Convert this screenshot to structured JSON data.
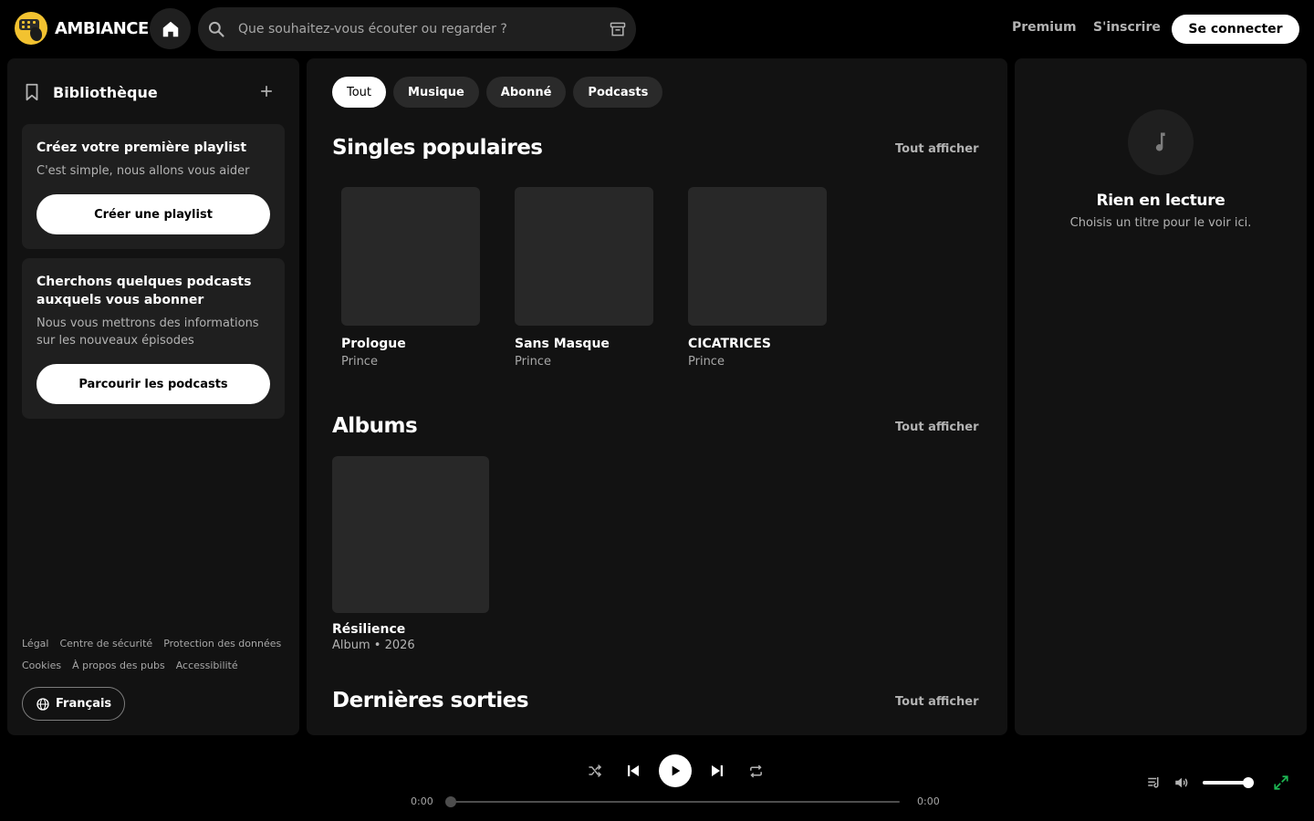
{
  "brand": {
    "name": "AMBIANCE"
  },
  "search": {
    "placeholder": "Que souhaitez-vous écouter ou regarder ?"
  },
  "top_nav": {
    "premium": "Premium",
    "signup": "S'inscrire",
    "login": "Se connecter"
  },
  "library": {
    "title": "Bibliothèque",
    "playlist_card": {
      "title": "Créez votre première playlist",
      "text": "C'est simple, nous allons vous aider",
      "button": "Créer une playlist"
    },
    "podcast_card": {
      "title": "Cherchons quelques podcasts auxquels vous abonner",
      "text": "Nous vous mettrons des informations sur les nouveaux épisodes",
      "button": "Parcourir les podcasts"
    },
    "legal_links": [
      "Légal",
      "Centre de sécurité",
      "Protection des données",
      "Cookies",
      "À propos des pubs",
      "Accessibilité"
    ],
    "language": "Français"
  },
  "filters": [
    "Tout",
    "Musique",
    "Abonné",
    "Podcasts"
  ],
  "sections": {
    "singles": {
      "title": "Singles populaires",
      "show_all": "Tout afficher",
      "items": [
        {
          "title": "Prologue",
          "artist": "Prince"
        },
        {
          "title": "Sans Masque",
          "artist": "Prince"
        },
        {
          "title": "CICATRICES",
          "artist": "Prince"
        }
      ]
    },
    "albums": {
      "title": "Albums",
      "show_all": "Tout afficher",
      "items": [
        {
          "title": "Résilience",
          "type": "Album",
          "year": "2026",
          "meta": "Album • 2026"
        }
      ]
    },
    "latest": {
      "title": "Dernières sorties",
      "show_all": "Tout afficher"
    }
  },
  "now_playing": {
    "title": "Rien en lecture",
    "subtitle": "Choisis un titre pour le voir ici."
  },
  "player": {
    "elapsed": "0:00",
    "duration": "0:00",
    "progress": 0,
    "volume": 0.9
  },
  "colors": {
    "background": "#000000",
    "panel": "#121212",
    "card": "#1f1f1f",
    "logo_yellow": "#f2c230",
    "accent_green": "#1db954"
  },
  "icons": [
    "home-icon",
    "search-icon",
    "browse-icon",
    "bookmark-icon",
    "plus-icon",
    "globe-icon",
    "music-note-icon",
    "shuffle-icon",
    "previous-icon",
    "play-icon",
    "next-icon",
    "repeat-icon",
    "queue-icon",
    "volume-icon",
    "expand-icon"
  ]
}
